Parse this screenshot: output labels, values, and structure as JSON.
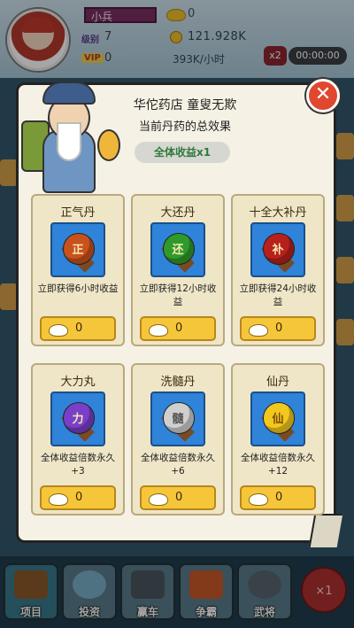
{
  "header": {
    "player_name": "小兵",
    "level_label": "级别",
    "level": "7",
    "vip_label": "VIP",
    "vip": "0",
    "ingots": "0",
    "coins": "121.928K",
    "rate": "393K/小时",
    "boost_label": "x2",
    "timer": "00:00:00"
  },
  "shop": {
    "title": "华佗药店 童叟无欺",
    "subtitle": "当前丹药的总效果",
    "total_effect": "全体收益x1",
    "close_label": "✕"
  },
  "pills": [
    {
      "name": "正气丹",
      "glyph": "正",
      "color": "#c8521c",
      "desc": "立即获得6小时收益",
      "price": "0"
    },
    {
      "name": "大还丹",
      "glyph": "还",
      "color": "#2f9a2a",
      "desc": "立即获得12小时收益",
      "price": "0"
    },
    {
      "name": "十全大补丹",
      "glyph": "补",
      "color": "#b8201c",
      "desc": "立即获得24小时收益",
      "price": "0"
    },
    {
      "name": "大力丸",
      "glyph": "力",
      "color": "#7a3fc8",
      "desc": "全体收益倍数永久+3",
      "price": "0"
    },
    {
      "name": "洗髓丹",
      "glyph": "髓",
      "color": "#cfcfcf",
      "desc": "全体收益倍数永久+6",
      "price": "0"
    },
    {
      "name": "仙丹",
      "glyph": "仙",
      "color": "#f2c81c",
      "desc": "全体收益倍数永久+12",
      "price": "0"
    }
  ],
  "nav": [
    {
      "label": "项目"
    },
    {
      "label": "投资"
    },
    {
      "label": "赢车"
    },
    {
      "label": "争霸"
    },
    {
      "label": "武将"
    }
  ],
  "speed_button": "×1",
  "colors": {
    "popup_bg": "#f5f1e4",
    "buy_button": "#f6c63a",
    "pill_box": "#2f83d8",
    "close_button": "#e0472f"
  }
}
